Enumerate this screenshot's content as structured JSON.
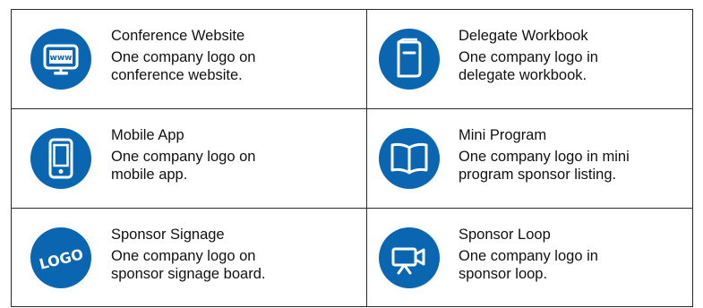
{
  "colors": {
    "icon_background": "#0a66b0",
    "border": "#2b2b2b",
    "text": "#111111"
  },
  "items": [
    {
      "icon": "www-monitor-icon",
      "title": "Conference Website",
      "description": "One company logo on\nconference website.",
      "icon_text": "www"
    },
    {
      "icon": "workbook-icon",
      "title": "Delegate Workbook",
      "description": "One company logo in\ndelegate workbook."
    },
    {
      "icon": "mobile-phone-icon",
      "title": "Mobile App",
      "description": "One company logo on\nmobile app."
    },
    {
      "icon": "open-book-icon",
      "title": "Mini Program",
      "description": "One company logo in mini\nprogram sponsor listing."
    },
    {
      "icon": "logo-icon",
      "title": "Sponsor Signage",
      "description": "One company logo on\nsponsor signage board.",
      "icon_text": "LOGO"
    },
    {
      "icon": "video-camera-icon",
      "title": "Sponsor Loop",
      "description": "One company logo in\nsponsor loop."
    }
  ]
}
